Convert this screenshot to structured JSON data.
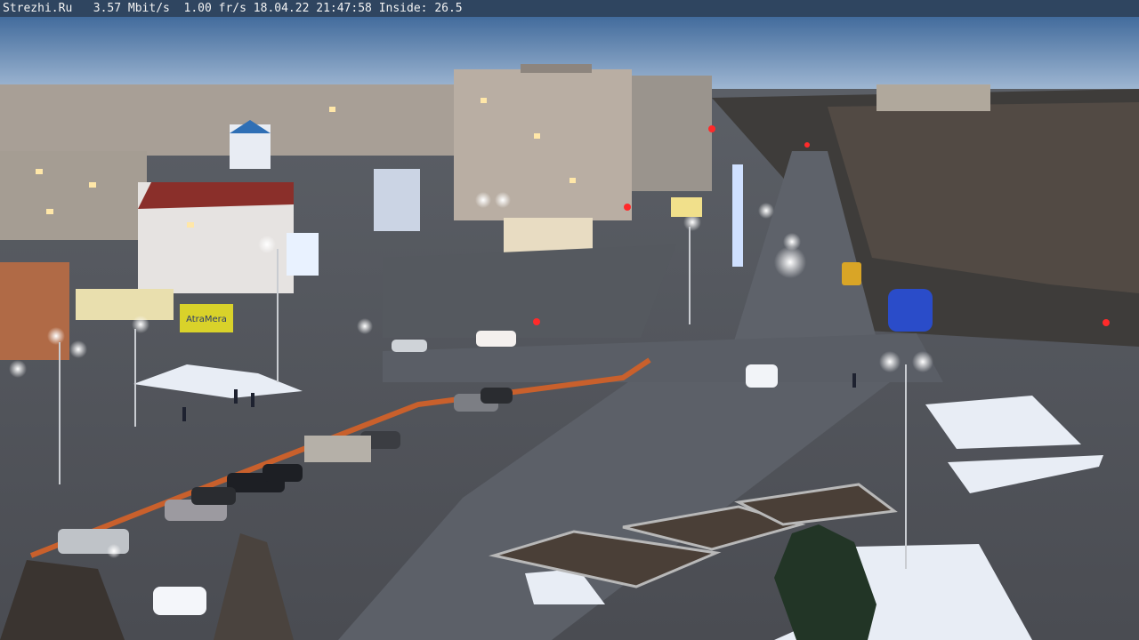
{
  "overlay": {
    "site": "Strezhi.Ru",
    "bitrate": "3.57 Mbit/s",
    "framerate": "1.00 fr/s",
    "date": "18.04.22",
    "time": "21:47:58",
    "inside": "Inside: 26.5"
  },
  "signs": {
    "billboard": "AtraMera"
  },
  "colors": {
    "sky_top": "#2d5a90",
    "sky_bottom": "#a9bfd8",
    "road": "#5a5f68",
    "snow": "#e8edf5",
    "overlay_bg": "#2f4560"
  }
}
